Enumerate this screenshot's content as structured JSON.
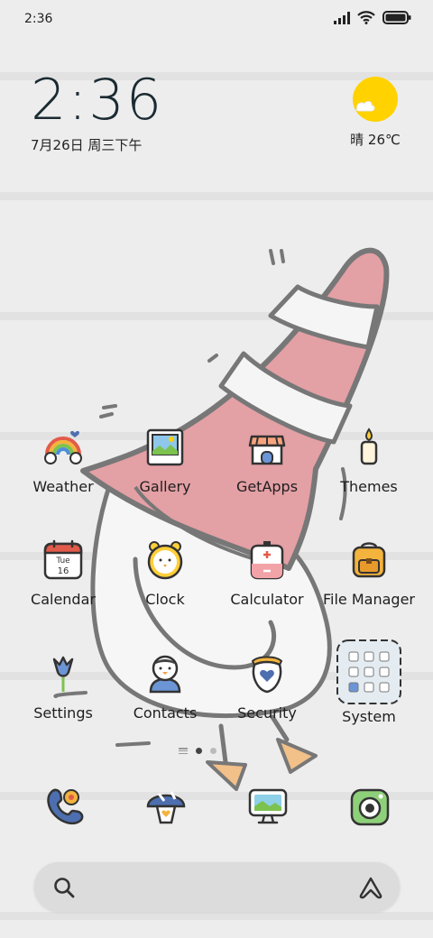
{
  "status_bar": {
    "time": "2:36"
  },
  "clock": {
    "time": "2:36",
    "date": "7月26日 周三下午"
  },
  "weather": {
    "text": "晴 26℃",
    "icon": "sunny-icon"
  },
  "apps": [
    {
      "label": "Weather",
      "icon": "rainbow-icon"
    },
    {
      "label": "Gallery",
      "icon": "photo-icon"
    },
    {
      "label": "GetApps",
      "icon": "store-icon"
    },
    {
      "label": "Themes",
      "icon": "candle-icon"
    },
    {
      "label": "Calendar",
      "icon": "calendar-icon",
      "calendar_day": "Tue",
      "calendar_date": "16"
    },
    {
      "label": "Clock",
      "icon": "alarm-clock-icon"
    },
    {
      "label": "Calculator",
      "icon": "calculator-icon"
    },
    {
      "label": "File Manager",
      "icon": "backpack-icon"
    },
    {
      "label": "Settings",
      "icon": "flower-icon"
    },
    {
      "label": "Contacts",
      "icon": "penguin-icon"
    },
    {
      "label": "Security",
      "icon": "shield-heart-icon"
    },
    {
      "label": "System",
      "icon": "folder-icon"
    }
  ],
  "page_indicator": {
    "pages": 3,
    "active": 1
  },
  "dock": [
    {
      "name": "phone",
      "icon": "phone-icon"
    },
    {
      "name": "messages",
      "icon": "mushroom-icon"
    },
    {
      "name": "browser",
      "icon": "monitor-icon"
    },
    {
      "name": "camera",
      "icon": "camera-icon"
    }
  ],
  "colors": {
    "background": "#ededed",
    "cone_pink": "#e3a0a5",
    "sun_yellow": "#ffd200",
    "duck_feet": "#f2c089"
  }
}
